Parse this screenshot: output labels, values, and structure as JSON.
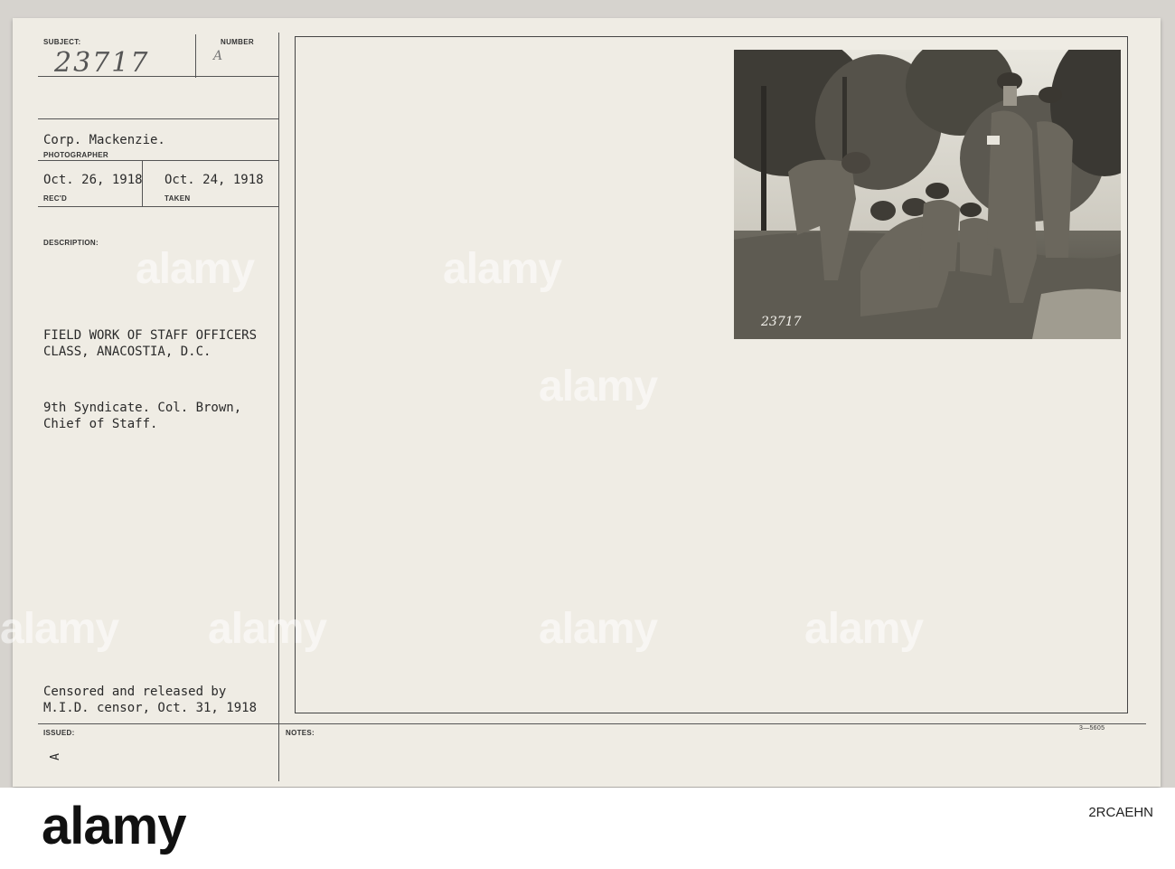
{
  "card": {
    "subject_label": "SUBJECT:",
    "subject_number": "23717",
    "number_label": "NUMBER",
    "number_value": "A",
    "photographer": "Corp. Mackenzie.",
    "photographer_label": "PHOTOGRAPHER",
    "recd_date": "Oct. 26, 1918",
    "recd_label": "REC'D",
    "taken_date": "Oct. 24, 1918",
    "taken_label": "TAKEN",
    "description_label": "DESCRIPTION:",
    "description_line1": "FIELD WORK OF STAFF OFFICERS",
    "description_line2": "CLASS, ANACOSTIA, D.C.",
    "detail_line1": "9th Syndicate. Col. Brown,",
    "detail_line2": "Chief of Staff.",
    "censor_line1": "Censored and released by",
    "censor_line2": "M.I.D. censor, Oct. 31, 1918",
    "issued_label": "ISSUED:",
    "issued_mark": "A",
    "notes_label": "NOTES:",
    "form_code": "3—5605",
    "photo_inscription": "23717"
  },
  "watermark": {
    "text": "alamy"
  },
  "footer": {
    "logo": "alamy",
    "image_id": "2RCAEHN"
  }
}
